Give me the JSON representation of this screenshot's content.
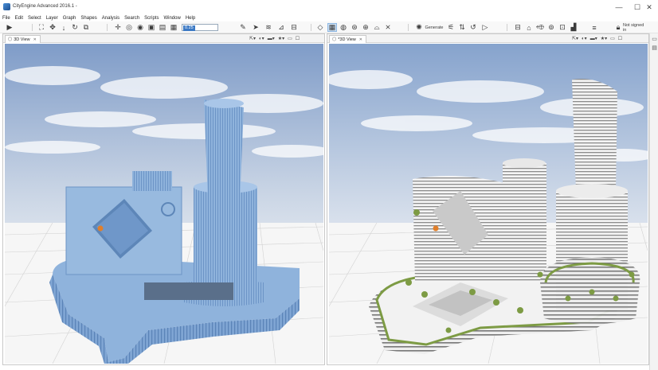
{
  "window": {
    "title": "CityEngine Advanced 2016.1 -",
    "controls": {
      "minimize": "—",
      "maximize": "☐",
      "close": "✕"
    }
  },
  "menu": [
    "File",
    "Edit",
    "Select",
    "Layer",
    "Graph",
    "Shapes",
    "Analysis",
    "Search",
    "Scripts",
    "Window",
    "Help"
  ],
  "toolbar": {
    "value_field": "0.25",
    "generate_label": "Generate",
    "account_label": "Not signed in",
    "icons": [
      "select-tool-icon",
      "frame-icon",
      "move-icon",
      "scale-icon",
      "rotate-icon",
      "transform-icon",
      "navigate-icon",
      "camera-icon",
      "orbit-icon",
      "view-icon",
      "shape-icon",
      "grid-icon",
      "polygon-tool-icon",
      "street-tool-icon",
      "brush-icon",
      "draw-icon",
      "globe-icon",
      "cloud-icon",
      "lasso-icon",
      "terrain-icon",
      "network-icon",
      "generate-icon",
      "cleanup-icon",
      "graph-icon",
      "undo-icon",
      "play-icon",
      "ruler-icon",
      "bridge-icon",
      "dimension-icon",
      "measure-icon",
      "eye-icon",
      "chart-icon",
      "lock-icon"
    ]
  },
  "views": [
    {
      "tab_label": "3D View",
      "tab_close": "✕"
    },
    {
      "tab_label": "*3D View",
      "tab_close": "✕"
    }
  ],
  "view_toolbar_icons": [
    "camera-menu-icon",
    "display-menu-icon",
    "layer-menu-icon",
    "bookmark-menu-icon"
  ],
  "colors": {
    "clay_model": "#8fb3dc",
    "clay_model_dark": "#5d86b8",
    "building_white": "#f2f2f2",
    "greenery": "#7d9b44",
    "sky_top": "#8aa6cf",
    "grid_ground": "#f6f6f6"
  }
}
